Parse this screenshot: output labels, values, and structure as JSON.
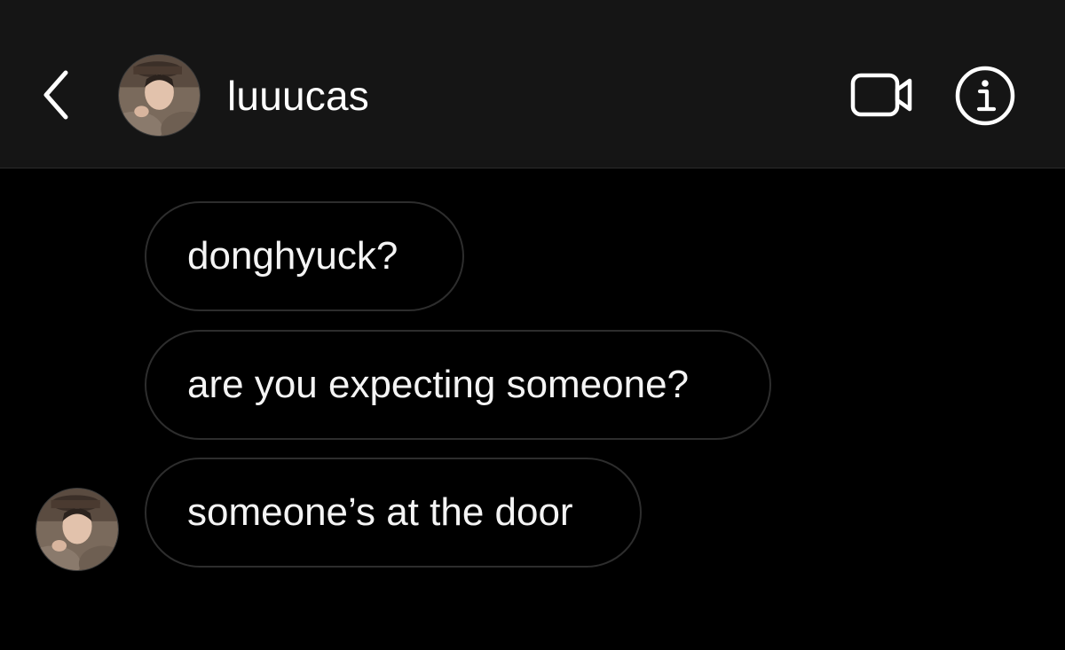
{
  "header": {
    "username": "luuucas",
    "back_icon": "chevron-left-icon",
    "video_icon": "video-camera-icon",
    "info_icon": "info-icon"
  },
  "messages": [
    {
      "text": "donghyuck?"
    },
    {
      "text": "are you expecting someone?"
    },
    {
      "text": "someone’s at the door"
    }
  ],
  "colors": {
    "background": "#000000",
    "header_background": "#151515",
    "bubble_border": "#2d2d2d",
    "text": "#ffffff"
  }
}
